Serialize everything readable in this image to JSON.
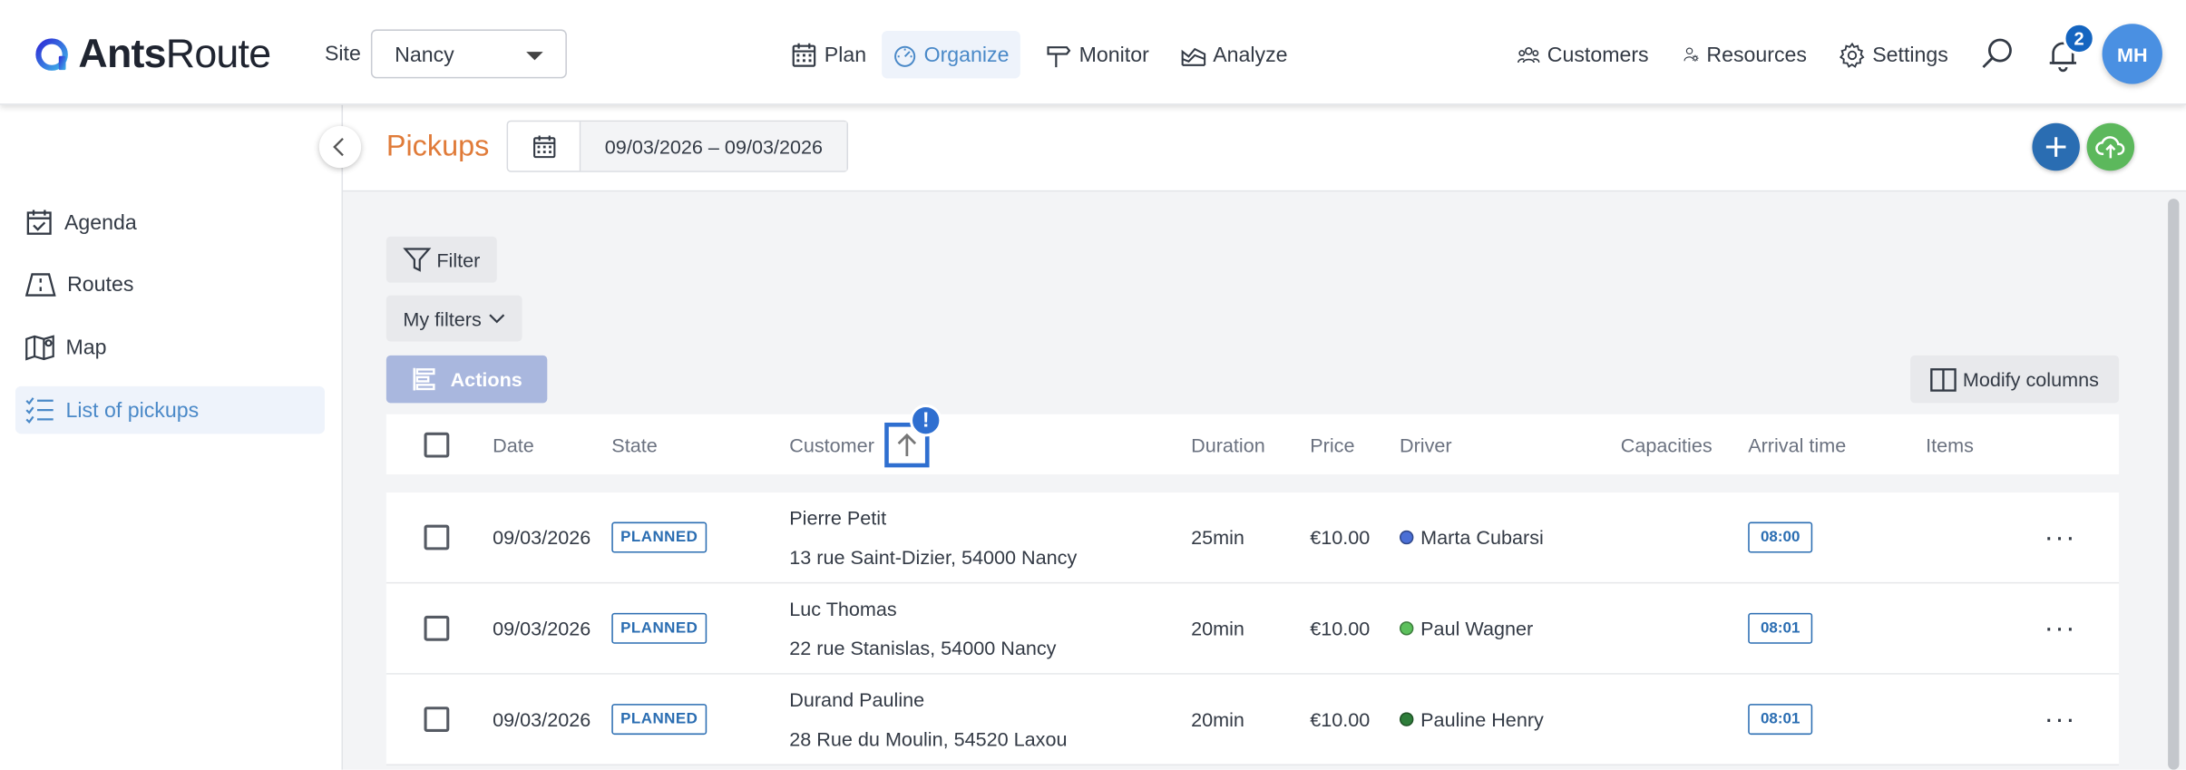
{
  "app": {
    "logo_bold": "Ants",
    "logo_light": "Route"
  },
  "header": {
    "site_label": "Site",
    "site_value": "Nancy",
    "nav": [
      {
        "label": "Plan",
        "icon": "calendar-grid-icon"
      },
      {
        "label": "Organize",
        "icon": "gauge-icon",
        "active": true
      },
      {
        "label": "Monitor",
        "icon": "signpost-icon"
      },
      {
        "label": "Analyze",
        "icon": "chart-icon"
      }
    ],
    "right_nav": [
      {
        "label": "Customers",
        "icon": "users-icon"
      },
      {
        "label": "Resources",
        "icon": "user-gear-icon"
      },
      {
        "label": "Settings",
        "icon": "gear-icon"
      }
    ],
    "notification_count": "2",
    "avatar_initials": "MH",
    "accent_color": "#4a89c8",
    "primary_color": "#2a6db2"
  },
  "sidebar": {
    "items": [
      {
        "label": "Agenda",
        "icon": "calendar-check-icon"
      },
      {
        "label": "Routes",
        "icon": "route-icon"
      },
      {
        "label": "Map",
        "icon": "map-icon"
      },
      {
        "label": "List of pickups",
        "icon": "list-icon",
        "active": true
      }
    ]
  },
  "page": {
    "title": "Pickups",
    "date_range": "09/03/2026 – 09/03/2026",
    "title_color": "#e07b39"
  },
  "toolbar": {
    "filter": "Filter",
    "my_filters": "My filters",
    "actions": "Actions",
    "modify_columns": "Modify columns"
  },
  "table": {
    "columns": {
      "date": "Date",
      "state": "State",
      "customer": "Customer",
      "duration": "Duration",
      "price": "Price",
      "driver": "Driver",
      "capacities": "Capacities",
      "arrival_time": "Arrival time",
      "items": "Items"
    },
    "sort_alert": "!",
    "rows": [
      {
        "date": "09/03/2026",
        "state": "PLANNED",
        "customer_name": "Pierre Petit",
        "customer_address": "13 rue Saint-Dizier, 54000 Nancy",
        "duration": "25min",
        "price": "€10.00",
        "driver": "Marta Cubarsi",
        "driver_color": "#4a6fd6",
        "arrival": "08:00"
      },
      {
        "date": "09/03/2026",
        "state": "PLANNED",
        "customer_name": "Luc Thomas",
        "customer_address": "22 rue Stanislas, 54000 Nancy",
        "duration": "20min",
        "price": "€10.00",
        "driver": "Paul Wagner",
        "driver_color": "#5cc05c",
        "arrival": "08:01"
      },
      {
        "date": "09/03/2026",
        "state": "PLANNED",
        "customer_name": "Durand Pauline",
        "customer_address": "28 Rue du Moulin, 54520 Laxou",
        "duration": "20min",
        "price": "€10.00",
        "driver": "Pauline Henry",
        "driver_color": "#2e7d3a",
        "arrival": "08:01"
      }
    ]
  }
}
